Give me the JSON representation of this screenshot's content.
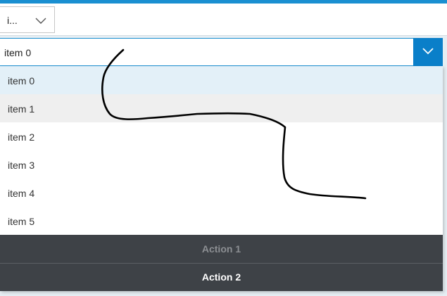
{
  "top_select": {
    "value": "i..."
  },
  "combo": {
    "value": "item 0"
  },
  "list": {
    "items": [
      {
        "label": "item 0"
      },
      {
        "label": "item 1"
      },
      {
        "label": "item 2"
      },
      {
        "label": "item 3"
      },
      {
        "label": "item 4"
      },
      {
        "label": "item 5"
      }
    ]
  },
  "actions": [
    {
      "label": "Action 1"
    },
    {
      "label": "Action 2"
    }
  ],
  "colors": {
    "accent": "#0a7fc9",
    "selected_item_bg": "#e3f0f8",
    "hover_item_bg": "#efefef",
    "action_bar_bg": "#3e4247"
  },
  "icons": [
    "chevron-down-icon",
    "chevron-down-icon"
  ]
}
